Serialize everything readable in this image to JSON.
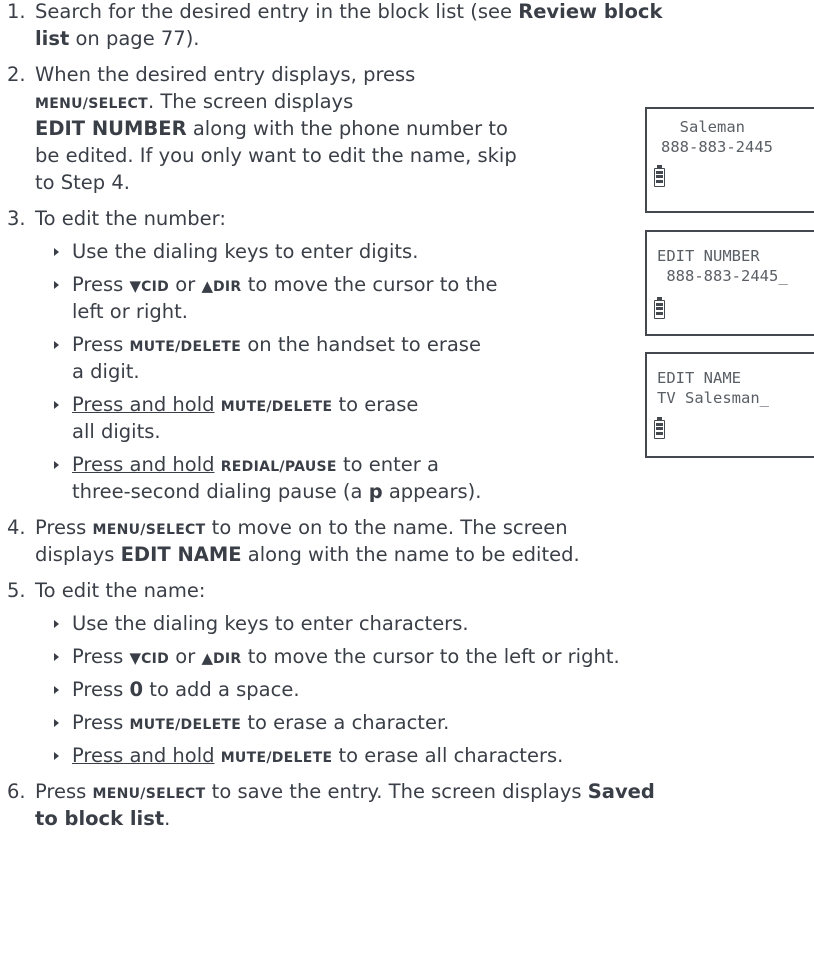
{
  "steps": {
    "s1": {
      "n": "1.",
      "a": "Search for the desired entry in the block list (see ",
      "b1": "Review block",
      "b2": "list",
      "c": " on page 77)."
    },
    "s2": {
      "n": "2.",
      "l1": "When the desired entry displays, press",
      "k": "MENU/SELECT",
      "l2": ". The screen displays",
      "b": "EDIT NUMBER",
      "l3": " along with the phone number to",
      "l4": "be edited. If you only want to edit the name, skip",
      "l5": "to Step 4."
    },
    "s3": {
      "n": "3.",
      "l1": "To edit the number:",
      "b1": "Use the dialing keys to enter digits.",
      "b2a": "Press ",
      "cid": "CID",
      "or": " or ",
      "dir": "DIR",
      "b2b": " to move the cursor to the",
      "b2c": "left or right.",
      "b3a": "Press ",
      "mute": "MUTE/DELETE",
      "b3b": " on the handset to erase",
      "b3c": "a digit.",
      "b4u": "Press and hold",
      "b4b": " to erase",
      "b4c": "all digits.",
      "b5u": "Press and hold",
      "redial": "REDIAL/PAUSE",
      "b5b": " to enter a",
      "b5c": "three-second dialing pause (a ",
      "p": "p",
      "b5d": " appears)."
    },
    "s4": {
      "n": "4.",
      "a": "Press ",
      "k": "MENU/SELECT",
      "b": " to move on to the name. The screen",
      "l2a": "displays ",
      "bn": "EDIT NAME",
      "l2b": " along with the name to be edited."
    },
    "s5": {
      "n": "5.",
      "l1": "To edit the name:",
      "b1": "Use the dialing keys to enter characters.",
      "b2a": "Press ",
      "cid": "CID",
      "or": " or ",
      "dir": "DIR",
      "b2b": " to move the cursor to the left or right.",
      "b3a": "Press ",
      "zero": "0",
      "b3b": " to add a space.",
      "b4a": "Press ",
      "mute": "MUTE/DELETE",
      "b4b": " to erase a character.",
      "b5u": "Press and hold",
      "b5b": " to erase all characters."
    },
    "s6": {
      "n": "6.",
      "a": "Press ",
      "k": "MENU/SELECT",
      "b": " to save the entry. The screen displays ",
      "bs": "Saved",
      "l2": "to block list",
      "dot": "."
    }
  },
  "screens": [
    {
      "line1": "  Saleman",
      "line2": "888-883-2445"
    },
    {
      "line1": "EDIT NUMBER",
      "line2": " 888-883-2445_"
    },
    {
      "line1": "EDIT NAME",
      "line2": "TV Salesman_"
    }
  ]
}
